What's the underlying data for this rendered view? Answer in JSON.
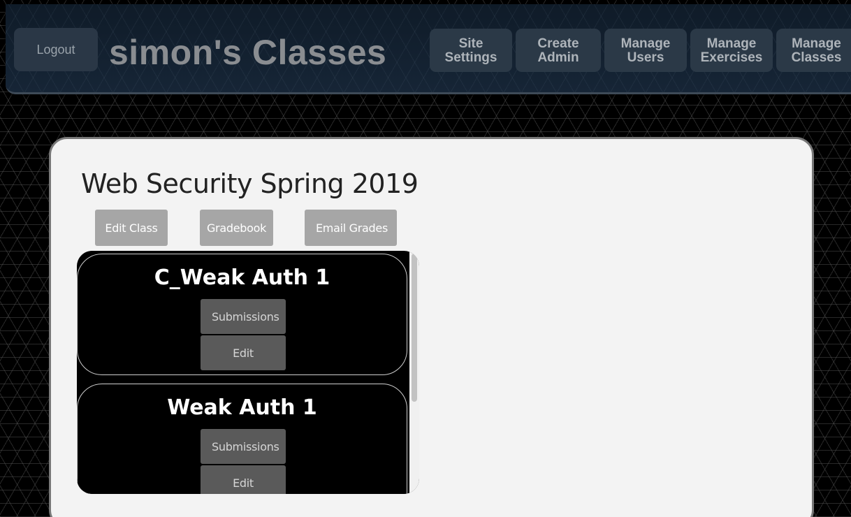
{
  "header": {
    "logout_label": "Logout",
    "title": "simon's Classes",
    "nav": [
      {
        "label": "Site\nSettings"
      },
      {
        "label": "Create\nAdmin"
      },
      {
        "label": "Manage\nUsers"
      },
      {
        "label": "Manage\nExercises"
      },
      {
        "label": "Manage\nClasses"
      }
    ]
  },
  "class": {
    "title": "Web Security Spring 2019",
    "actions": {
      "edit_class": "Edit Class",
      "gradebook": "Gradebook",
      "email_grades": "Email Grades"
    }
  },
  "exercises": [
    {
      "name": "C_Weak Auth 1",
      "submissions_label": "Submissions",
      "edit_label": "Edit"
    },
    {
      "name": "Weak Auth 1",
      "submissions_label": "Submissions",
      "edit_label": "Edit"
    }
  ],
  "colors": {
    "header_bg": "#131f2d",
    "card_bg": "#f3f3f3",
    "button_gray": "#a6a6a6",
    "exercise_button": "#5a5a5a"
  }
}
